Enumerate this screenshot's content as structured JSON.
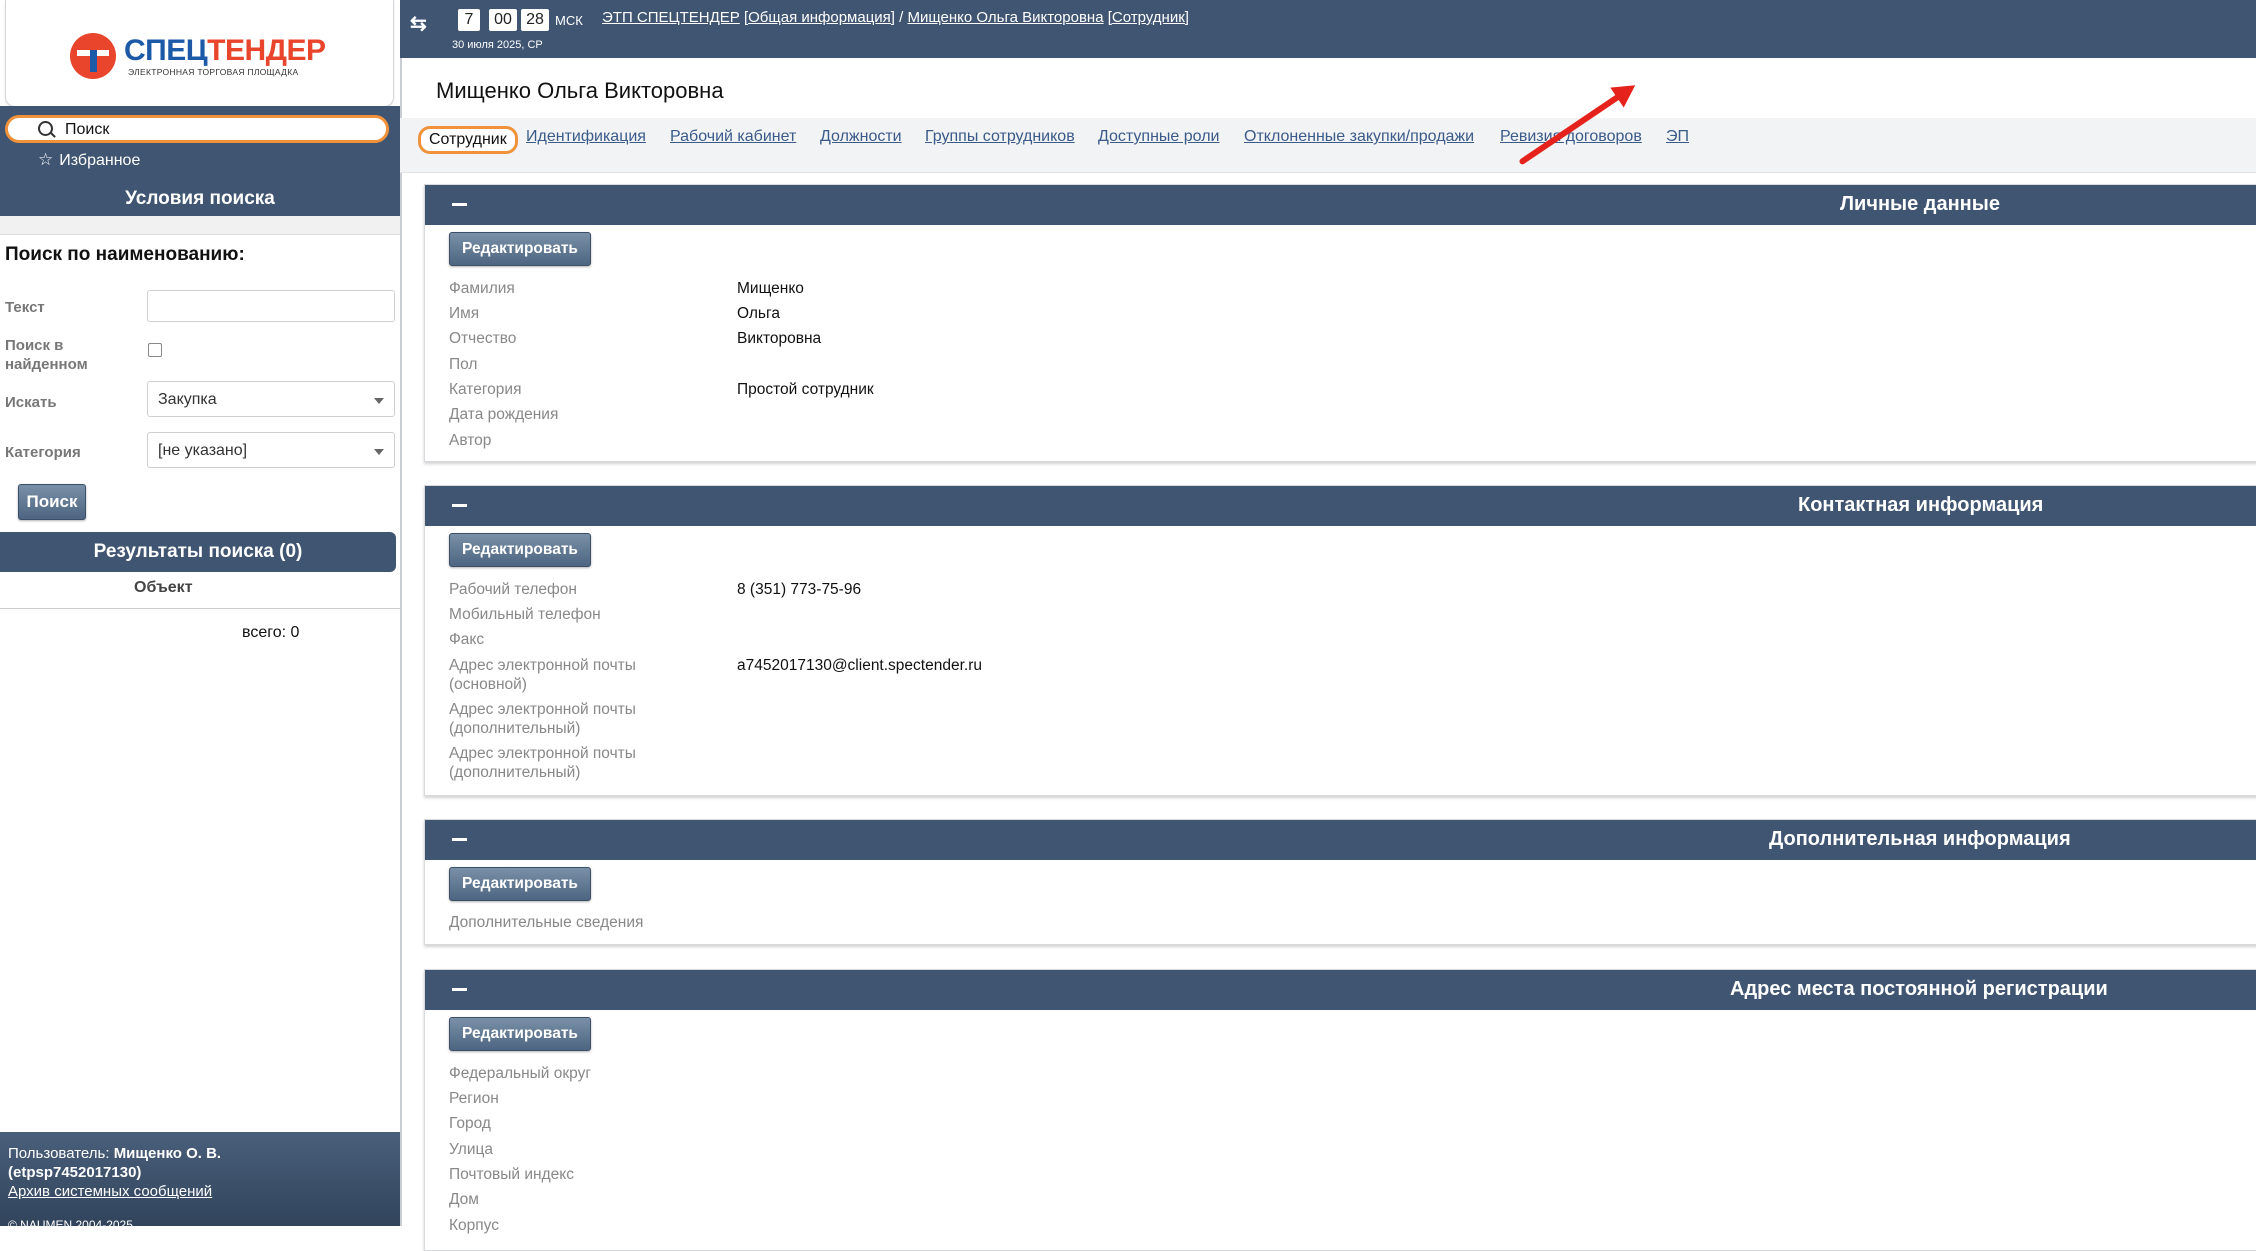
{
  "logo": {
    "part1": "СПЕЦ",
    "part2": "ТЕНДЕР",
    "subtitle": "ЭЛЕКТРОННАЯ ТОРГОВАЯ ПЛОЩАДКА"
  },
  "sidebar": {
    "search_label": "Поиск",
    "favorites_label": "Избранное",
    "conditions_title": "Условия поиска",
    "name_search_title": "Поиск по наименованию:",
    "fields": {
      "text_label": "Текст",
      "in_found_label_1": "Поиск в",
      "in_found_label_2": "найденном",
      "search_for_label": "Искать",
      "search_for_value": "Закупка",
      "category_label": "Категория",
      "category_value": "[не указано]"
    },
    "search_button": "Поиск",
    "results_title": "Результаты поиска (0)",
    "results_column": "Объект",
    "results_total": "всего: 0",
    "footer": {
      "user_prefix": "Пользователь: ",
      "user_name": "Мищенко О. В.",
      "user_login": "(etpsp7452017130)",
      "archive_link": "Архив системных сообщений",
      "copyright": "© NAUMEN 2004-2025"
    }
  },
  "topbar": {
    "clock_h": "7",
    "clock_m": "00",
    "clock_s": "28",
    "tz": "МСК",
    "date": "30 июля 2025, СР",
    "crumb_1": "ЭТП СПЕЦТЕНДЕР",
    "crumb_2": "[Общая информация]",
    "crumb_sep": " / ",
    "crumb_3": "Мищенко Ольга Викторовна",
    "crumb_4": "[Сотрудник]"
  },
  "page_title": "Мищенко Ольга Викторовна",
  "tabs": [
    {
      "label": "Сотрудник",
      "active": true
    },
    {
      "label": "Идентификация"
    },
    {
      "label": "Рабочий кабинет"
    },
    {
      "label": "Должности"
    },
    {
      "label": "Группы сотрудников"
    },
    {
      "label": "Доступные роли"
    },
    {
      "label": "Отклоненные закупки/продажи"
    },
    {
      "label": "Ревизия договоров"
    },
    {
      "label": "ЭП"
    }
  ],
  "edit_label": "Редактировать",
  "panels": {
    "personal": {
      "title": "Личные данные",
      "rows": [
        {
          "label": "Фамилия",
          "value": "Мищенко"
        },
        {
          "label": "Имя",
          "value": "Ольга"
        },
        {
          "label": "Отчество",
          "value": "Викторовна"
        },
        {
          "label": "Пол",
          "value": ""
        },
        {
          "label": "Категория",
          "value": "Простой сотрудник"
        },
        {
          "label": "Дата рождения",
          "value": ""
        },
        {
          "label": "Автор",
          "value": ""
        }
      ]
    },
    "contact": {
      "title": "Контактная информация",
      "rows": [
        {
          "label": "Рабочий телефон",
          "value": "8 (351) 773-75-96"
        },
        {
          "label": "Мобильный телефон",
          "value": ""
        },
        {
          "label": "Факс",
          "value": ""
        },
        {
          "label": "Адрес электронной почты",
          "label2": "(основной)",
          "value": "a7452017130@client.spectender.ru"
        },
        {
          "label": "Адрес электронной почты",
          "label2": "(дополнительный)",
          "value": ""
        },
        {
          "label": "Адрес электронной почты",
          "label2": "(дополнительный)",
          "value": ""
        }
      ]
    },
    "additional": {
      "title": "Дополнительная информация",
      "rows": [
        {
          "label": "Дополнительные сведения",
          "value": ""
        }
      ]
    },
    "address": {
      "title": "Адрес места постоянной регистрации",
      "rows": [
        {
          "label": "Федеральный округ",
          "value": ""
        },
        {
          "label": "Регион",
          "value": ""
        },
        {
          "label": "Город",
          "value": ""
        },
        {
          "label": "Улица",
          "value": ""
        },
        {
          "label": "Почтовый индекс",
          "value": ""
        },
        {
          "label": "Дом",
          "value": ""
        },
        {
          "label": "Корпус",
          "value": ""
        }
      ]
    }
  }
}
